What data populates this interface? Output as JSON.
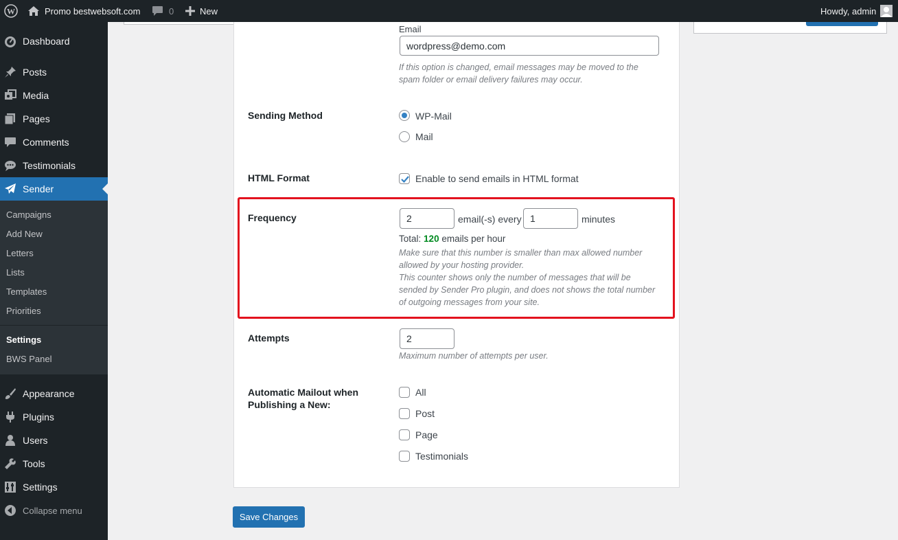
{
  "adminbar": {
    "site_name": "Promo bestwebsoft.com",
    "comments_count": "0",
    "new_label": "New",
    "howdy": "Howdy, admin"
  },
  "sidebar": {
    "items_top": [
      {
        "label": "Dashboard",
        "icon": "dashboard-icon"
      },
      {
        "label": "Posts",
        "icon": "pin-icon"
      },
      {
        "label": "Media",
        "icon": "media-icon"
      },
      {
        "label": "Pages",
        "icon": "pages-icon"
      },
      {
        "label": "Comments",
        "icon": "comment-icon"
      },
      {
        "label": "Testimonials",
        "icon": "speech-bubble-icon"
      },
      {
        "label": "Sender",
        "icon": "paper-plane-icon"
      }
    ],
    "submenu": [
      "Campaigns",
      "Add New",
      "Letters",
      "Lists",
      "Templates",
      "Priorities",
      "Settings",
      "BWS Panel"
    ],
    "items_bottom": [
      {
        "label": "Appearance",
        "icon": "brush-icon"
      },
      {
        "label": "Plugins",
        "icon": "plug-icon"
      },
      {
        "label": "Users",
        "icon": "user-icon"
      },
      {
        "label": "Tools",
        "icon": "wrench-icon"
      },
      {
        "label": "Settings",
        "icon": "settings-icon"
      },
      {
        "label": "Collapse menu",
        "icon": "collapse-icon"
      }
    ]
  },
  "form": {
    "email": {
      "label": "Email",
      "value": "wordpress@demo.com",
      "desc_line1": "If this option is changed, email messages may be moved to the",
      "desc_line2": "spam folder or email delivery failures may occur."
    },
    "sending_method": {
      "label": "Sending Method",
      "options": [
        "WP-Mail",
        "Mail"
      ],
      "selected": "WP-Mail"
    },
    "html_format": {
      "label": "HTML Format",
      "checkbox_label": "Enable to send emails in HTML format",
      "checked": true
    },
    "frequency": {
      "label": "Frequency",
      "emails_value": "2",
      "emails_text": "email(-s) every",
      "minutes_value": "1",
      "minutes_text": "minutes",
      "total_prefix": "Total:",
      "total_value": "120",
      "total_suffix": "emails per hour",
      "desc_lines": [
        "Make sure that this number is smaller than max allowed number",
        "allowed by your hosting provider.",
        "This counter shows only the number of messages that will be",
        "sended by Sender Pro plugin, and does not shows the total number",
        "of outgoing messages from your site."
      ]
    },
    "attempts": {
      "label": "Attempts",
      "value": "2",
      "desc": "Maximum number of attempts per user."
    },
    "automatic_mailout": {
      "label_line1": "Automatic Mailout when",
      "label_line2": "Publishing a New:",
      "options": [
        "All",
        "Post",
        "Page",
        "Testimonials"
      ]
    }
  },
  "save_button": "Save Changes",
  "colors": {
    "accent": "#2271b1",
    "sidebar_bg": "#1d2327",
    "highlight_border": "#e3121e",
    "total_value_color": "#008a20"
  }
}
